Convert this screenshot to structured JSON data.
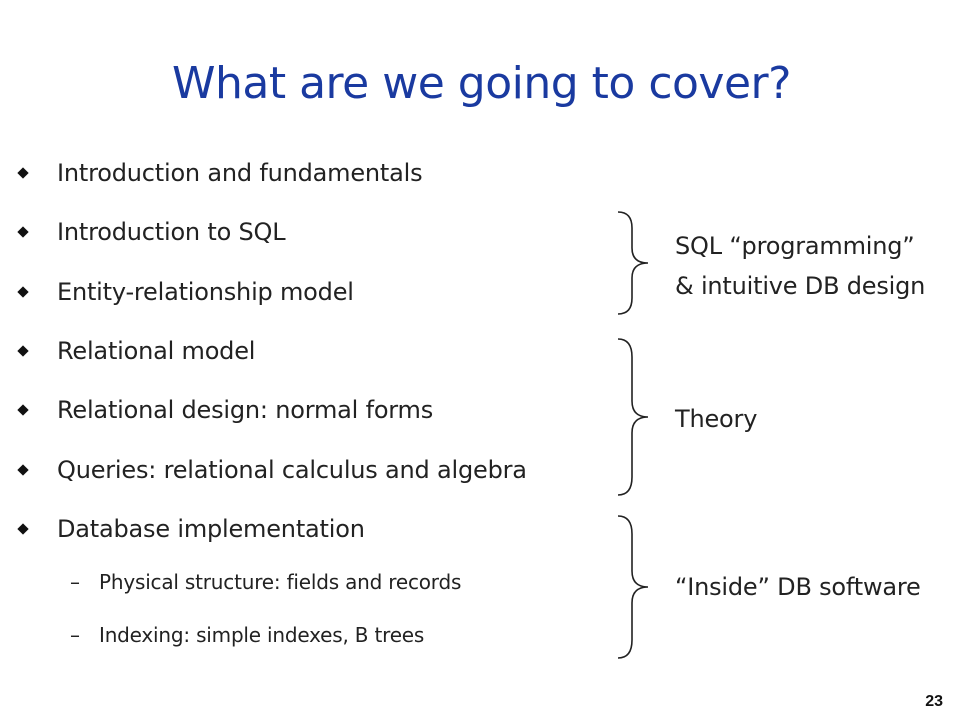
{
  "title": "What are we going to cover?",
  "bullets": [
    "Introduction and fundamentals",
    "Introduction to SQL",
    "Entity-relationship model",
    "Relational model",
    "Relational design: normal forms",
    "Queries: relational calculus and algebra",
    "Database implementation"
  ],
  "dash_symbol": "–",
  "sub_bullets": [
    "Physical structure: fields and records",
    "Indexing: simple indexes, B trees"
  ],
  "groups": [
    {
      "lines": [
        "SQL “programming”",
        "& intuitive DB design"
      ]
    },
    {
      "lines": [
        "Theory"
      ]
    },
    {
      "lines": [
        "“Inside” DB software"
      ]
    }
  ],
  "page_number": "23"
}
